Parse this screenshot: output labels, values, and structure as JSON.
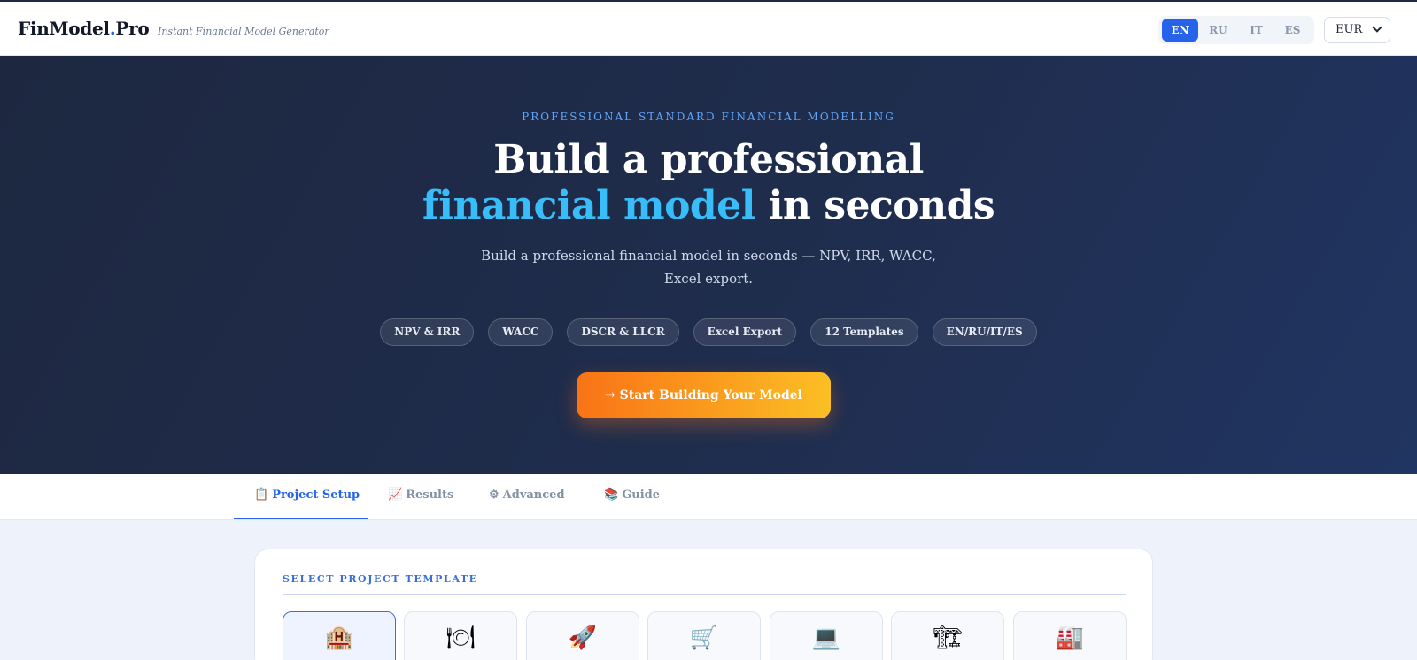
{
  "header": {
    "logo_main": "FinModel",
    "logo_dot": ".",
    "logo_suffix": "Pro",
    "tagline": "Instant Financial Model Generator",
    "languages": [
      "EN",
      "RU",
      "IT",
      "ES"
    ],
    "active_language": "EN",
    "currency": "EUR"
  },
  "hero": {
    "eyebrow": "PROFESSIONAL STANDARD FINANCIAL MODELLING",
    "headline_line1": "Build a professional",
    "headline_accent": "financial model",
    "headline_rest": " in seconds",
    "subtext": "Build a professional financial model in seconds — NPV, IRR, WACC, Excel export.",
    "chips": [
      "NPV & IRR",
      "WACC",
      "DSCR & LLCR",
      "Excel Export",
      "12 Templates",
      "EN/RU/IT/ES"
    ],
    "cta_label": "→ Start Building Your Model"
  },
  "tabs": [
    {
      "icon": "📋",
      "label": "Project Setup",
      "active": true
    },
    {
      "icon": "📈",
      "label": "Results",
      "active": false
    },
    {
      "icon": "⚙",
      "label": "Advanced",
      "active": false
    },
    {
      "icon": "📚",
      "label": "Guide",
      "active": false
    }
  ],
  "templates": {
    "title": "SELECT PROJECT TEMPLATE",
    "items": [
      {
        "icon_name": "hotel-icon",
        "glyph": "🏨",
        "selected": true
      },
      {
        "icon_name": "restaurant-icon",
        "glyph": "🍽",
        "selected": false
      },
      {
        "icon_name": "rocket-icon",
        "glyph": "🚀",
        "selected": false
      },
      {
        "icon_name": "shopping-cart-icon",
        "glyph": "🛒",
        "selected": false
      },
      {
        "icon_name": "laptop-icon",
        "glyph": "💻",
        "selected": false
      },
      {
        "icon_name": "construction-icon",
        "glyph": "🏗",
        "selected": false
      },
      {
        "icon_name": "factory-icon",
        "glyph": "🏭",
        "selected": false
      }
    ]
  },
  "colors": {
    "accent": "#2563eb",
    "hero_bg": "#1f2d4d",
    "headline_accent": "#38bdf8",
    "cta_start": "#f97316",
    "cta_end": "#fbbf24"
  }
}
